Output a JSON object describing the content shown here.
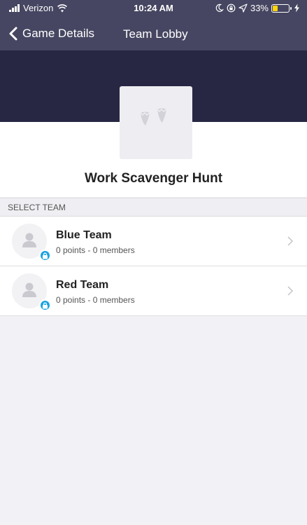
{
  "status_bar": {
    "carrier": "Verizon",
    "time": "10:24 AM",
    "battery_percent": "33%",
    "battery_level": 0.33,
    "icons": [
      "signal-icon",
      "wifi-icon",
      "moon-icon",
      "lock-rotation-icon",
      "location-icon",
      "battery-icon",
      "charging-icon"
    ]
  },
  "nav": {
    "back_label": "Game Details",
    "title": "Team Lobby"
  },
  "game": {
    "title": "Work Scavenger Hunt",
    "image_icon": "footprints-icon"
  },
  "section": {
    "label": "SELECT TEAM"
  },
  "teams": [
    {
      "name": "Blue Team",
      "meta": "0 points - 0 members",
      "locked": true
    },
    {
      "name": "Red Team",
      "meta": "0 points - 0 members",
      "locked": true
    }
  ],
  "colors": {
    "nav_bg": "#464662",
    "banner_bg": "#272744",
    "accent": "#1aa3e0",
    "battery": "#ffd60a",
    "background": "#f2f2f6"
  }
}
